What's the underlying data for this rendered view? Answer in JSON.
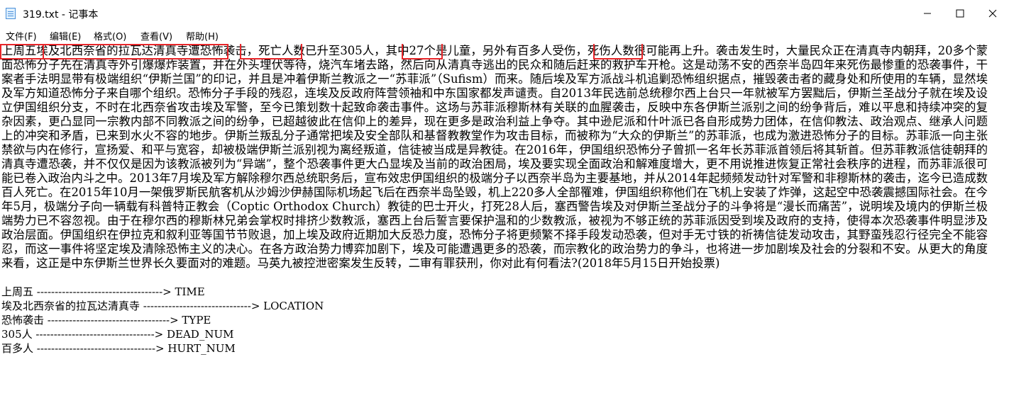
{
  "window": {
    "title": "319.txt - 记事本",
    "app_icon": "notepad-icon",
    "minimize_icon": "minimize-icon",
    "maximize_icon": "maximize-icon",
    "close_icon": "close-icon"
  },
  "menu": {
    "items": [
      "文件(F)",
      "编辑(E)",
      "格式(O)",
      "查看(V)",
      "帮助(H)"
    ]
  },
  "content": {
    "paragraph": "上周五埃及北西奈省的拉瓦达清真寺遭恐怖袭击，死亡人数已升至305人，其中27个是儿童，另外有百多人受伤，死伤人数很可能再上升。袭击发生时，大量民众正在清真寺内朝拜，20多个蒙面恐怖分子先在清真寺外引爆爆炸装置，并在外头埋伏等待，烧汽车堵去路，然后向从清真寺逃出的民众和随后赶来的救护车开枪。这是动荡不安的西奈半岛四年来死伤最惨重的恐袭事件，干案者手法明显带有极端组织“伊斯兰国”的印记，并且是冲着伊斯兰教派之一“苏菲派”（Sufism）而来。随后埃及军方派战斗机追剿恐怖组织据点，摧毁袭击者的藏身处和所使用的车辆，显然埃及军方知道恐怖分子来自哪个组织。恐怖分子手段的残忍，连埃及反政府阵营领袖和中东国家都发声谴责。自2013年民选前总统穆尔西上台只一年就被军方罢黜后，伊斯兰圣战分子就在埃及设立伊国组织分支，不时在北西奈省攻击埃及军警，至今已策划数十起致命袭击事件。这场与苏菲派穆斯林有关联的血腥袭击，反映中东各伊斯兰派别之间的纷争背后，难以平息和持续冲突的复杂因素，更凸显同一宗教内部不同教派之间的纷争，已超越彼此在信仰上的差异，现在更多是政治利益上争夺。其中逊尼派和什叶派已各自形成势力团体，在信仰教法、政治观点、继承人问题上的冲突和矛盾，已来到水火不容的地步。伊斯兰叛乱分子通常把埃及安全部队和基督教教堂作为攻击目标，而被称为“大众的伊斯兰”的苏菲派，也成为激进恐怖分子的目标。苏菲派一向主张禁欲与内在修行，宣扬爱、和平与宽容，却被极端伊斯兰派别视为离经叛道，信徒被当成是异教徒。在2016年，伊国组织恐怖分子曾抓一名年长苏菲派首领后将其斩首。但苏菲教派信徒朝拜的清真寺遭恐袭，并不仅仅是因为该教派被列为“异端”，整个恐袭事件更大凸显埃及当前的政治困局，埃及要实现全面政治和解难度增大，更不用说推进恢复正常社会秩序的进程，而苏菲派很可能已卷入政治内斗之中。2013年7月埃及军方解除穆尔西总统职务后，宣布效忠伊国组织的极端分子以西奈半岛为主要基地，并从2014年起频频发动针对军警和非穆斯林的袭击，迄今已造成数百人死亡。在2015年10月一架俄罗斯民航客机从沙姆沙伊赫国际机场起飞后在西奈半岛坠毁，机上220多人全部罹难，伊国组织称他们在飞机上安装了炸弹，这起空中恐袭震撼国际社会。在今年5月，极端分子向一辆载有科普特正教会（Coptic Orthodox Church）教徒的巴士开火，打死28人后，塞西警告埃及对伊斯兰圣战分子的斗争将是“漫长而痛苦”，说明埃及境内的伊斯兰极端势力已不容忽视。由于在穆尔西的穆斯林兄弟会掌权时排挤少数教派，塞西上台后誓言要保护温和的少数教派，被视为不够正统的苏菲派因受到埃及政府的支持，使得本次恐袭事件明显涉及政治层面。伊国组织在伊拉克和叙利亚等国节节败退，加上埃及政府近期加大反恐力度，恐怖分子将更频繁不择手段发动恐袭，但对手无寸铁的祈祷信徒发动攻击，其野蛮残忍行径完全不能容忍，而这一事件将坚定埃及清除恐怖主义的决心。在各方政治势力博弈加剧下，埃及可能遭遇更多的恐袭，而宗教化的政治势力的争斗，也将进一步加剧埃及社会的分裂和不安。从更大的角度来看，这正是中东伊斯兰世界长久要面对的难题。马英九被控泄密案发生反转，二审有罪获刑，你对此有何看法?(2018年5月15日开始投票)",
    "lines": [
      "上周五 -----------------------------------> TIME",
      "埃及北西奈省的拉瓦达清真寺 ------------------------------> LOCATION",
      "恐怖袭击 ----------------------------------> TYPE",
      "305人 ---------------------------------> DEAD_NUM",
      "百多人 ---------------------------------> HURT_NUM"
    ]
  },
  "annotation_color": "#e8262a"
}
